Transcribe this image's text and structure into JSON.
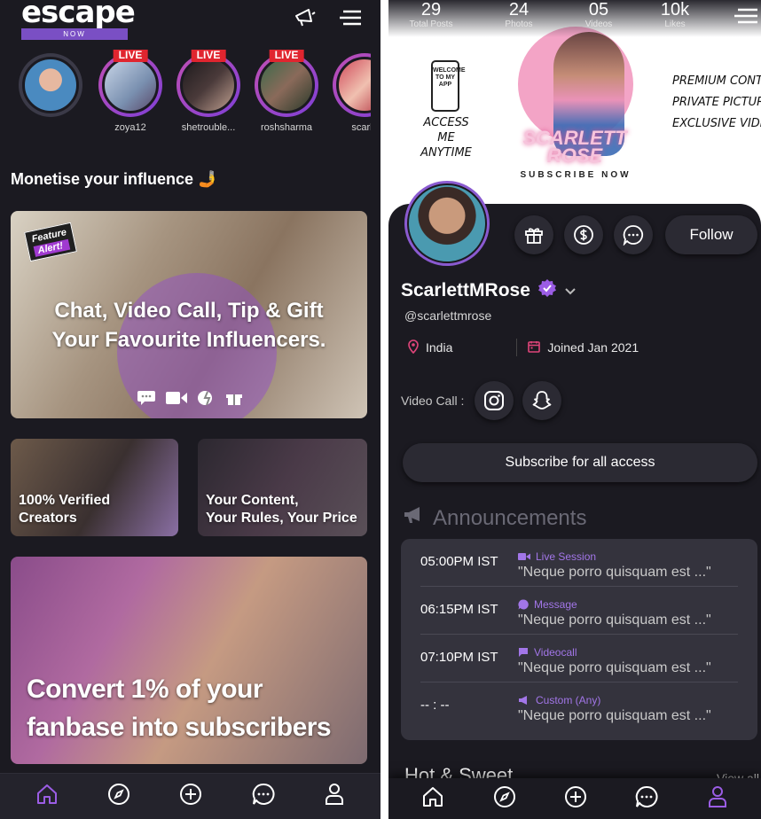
{
  "left": {
    "logo": {
      "word": "escape",
      "sub": "NOW"
    },
    "stories": [
      {
        "name": "",
        "live": ""
      },
      {
        "name": "zoya12",
        "live": "LIVE"
      },
      {
        "name": "shetrouble...",
        "live": "LIVE"
      },
      {
        "name": "roshsharma",
        "live": "LIVE"
      },
      {
        "name": "scarle",
        "live": ""
      }
    ],
    "section_title": "Monetise your influence 🤳",
    "card1": {
      "badge_line1": "Feature",
      "badge_line2": "Alert!",
      "line1": "Chat, Video Call, Tip & Gift",
      "line2": "Your Favourite Influencers."
    },
    "card2": {
      "line1": "100% Verified",
      "line2": "Creators"
    },
    "card3": {
      "line1": "Your Content,",
      "line2": "Your Rules, Your Price"
    },
    "card4": {
      "line1": "Convert 1% of your",
      "line2": "fanbase into subscribers"
    }
  },
  "right": {
    "stats": [
      {
        "value": "29",
        "label": "Total Posts"
      },
      {
        "value": "24",
        "label": "Photos"
      },
      {
        "value": "05",
        "label": "Videos"
      },
      {
        "value": "10k",
        "label": "Likes"
      }
    ],
    "hero": {
      "phone_text": "WELCOME TO MY APP",
      "access": "ACCESS ME ANYTIME",
      "premium": [
        "PREMIUM CONTENT",
        "PRIVATE PICTURES",
        "EXCLUSIVE VIDEOS"
      ],
      "brand_line1": "SCARLETT",
      "brand_line2": "ROSE",
      "subscribe": "SUBSCRIBE NOW"
    },
    "follow_label": "Follow",
    "name": "ScarlettMRose",
    "handle": "@scarlettmrose",
    "location": "India",
    "joined": "Joined Jan 2021",
    "video_call_label": "Video Call :",
    "subscribe_label": "Subscribe for all access",
    "announcements_title": "Announcements",
    "announcements": [
      {
        "time": "05:00PM IST",
        "type": "Live Session",
        "text": "\"Neque porro quisquam est ...\""
      },
      {
        "time": "06:15PM IST",
        "type": "Message",
        "text": "\"Neque porro quisquam est ...\""
      },
      {
        "time": "07:10PM IST",
        "type": "Videocall",
        "text": "\"Neque porro quisquam est ...\""
      },
      {
        "time": "-- : --",
        "type": "Custom (Any)",
        "text": "\"Neque porro quisquam est ...\""
      }
    ],
    "hot_title": "Hot & Sweet",
    "view_all": "View all"
  },
  "colors": {
    "accent": "#9b5de5",
    "live": "#e0252f",
    "bg_dark": "#1b1a21"
  }
}
